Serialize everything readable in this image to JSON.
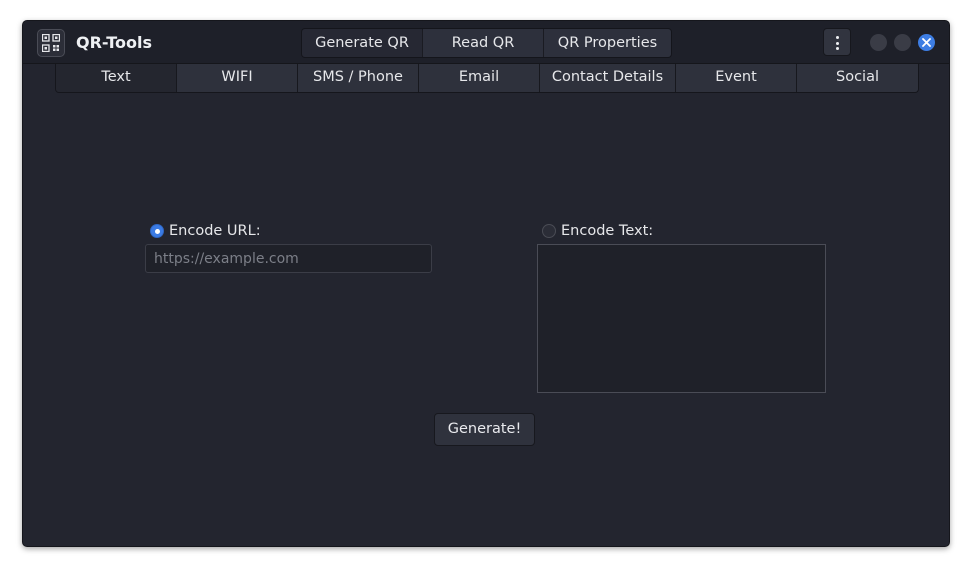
{
  "app": {
    "title": "QR-Tools",
    "icon": "qr-code-icon"
  },
  "view_switcher": {
    "items": [
      {
        "label": "Generate QR",
        "active": true
      },
      {
        "label": "Read QR",
        "active": false
      },
      {
        "label": "QR Properties",
        "active": false
      }
    ]
  },
  "header_controls": {
    "menu_icon": "vertical-dots-icon",
    "minimize_icon": "minimize-icon",
    "maximize_icon": "maximize-icon",
    "close_icon": "close-icon"
  },
  "tabs": {
    "items": [
      {
        "label": "Text",
        "active": true
      },
      {
        "label": "WIFI",
        "active": false
      },
      {
        "label": "SMS / Phone",
        "active": false
      },
      {
        "label": "Email",
        "active": false
      },
      {
        "label": "Contact Details",
        "active": false
      },
      {
        "label": "Event",
        "active": false
      },
      {
        "label": "Social",
        "active": false
      }
    ]
  },
  "form": {
    "url_option": {
      "label": "Encode URL:",
      "selected": true
    },
    "url_input": {
      "value": "",
      "placeholder": "https://example.com"
    },
    "text_option": {
      "label": "Encode Text:",
      "selected": false
    },
    "text_input": {
      "value": ""
    },
    "generate_label": "Generate!"
  },
  "colors": {
    "accent": "#3b7be4",
    "window_bg": "#23252f",
    "headerbar_bg": "#1e2029"
  }
}
